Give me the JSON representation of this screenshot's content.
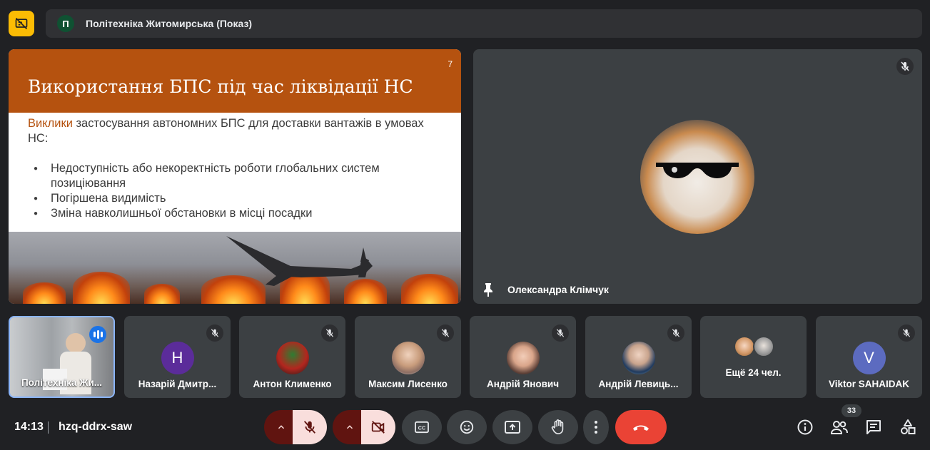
{
  "meeting": {
    "presenter_avatar_letter": "П",
    "presentation_title": "Політехніка Житомирська (Показ)",
    "time": "14:13",
    "code": "hzq-ddrx-saw",
    "participants_count": "33"
  },
  "slide": {
    "title": "Використання БПС під час ліквідації НС",
    "page_number": "7",
    "intro_highlight": "Виклики",
    "intro_rest": " застосування автономних БПС для доставки вантажів в умовах НС:",
    "bullets": [
      "Недоступність або некоректність роботи глобальних систем позиціювання",
      "Погіршена видимість",
      "Зміна навколишньої обстановки в місці посадки"
    ]
  },
  "pinned": {
    "name": "Олександра Клімчук"
  },
  "participants": [
    {
      "name": "Політехніка Жи...",
      "avatar": ""
    },
    {
      "name": "Назарій Дмитр...",
      "avatar": "Н",
      "color": "#5b2c9a"
    },
    {
      "name": "Антон Клименко",
      "avatar": "",
      "color": "#b3261e"
    },
    {
      "name": "Максим Лисенко",
      "avatar": "",
      "color": "#8d6e63"
    },
    {
      "name": "Андрій Янович",
      "avatar": "",
      "color": "#6d4c41"
    },
    {
      "name": "Андрій Левиць...",
      "avatar": "",
      "color": "#546e7a"
    },
    {
      "name": "Ещё 24 чел.",
      "avatar": ""
    },
    {
      "name": "Viktor SAHAIDAK",
      "avatar": "V",
      "color": "#5c6bc0"
    }
  ],
  "colors": {
    "accent_yellow": "#fbbc04",
    "slide_header": "#b5520f",
    "end_call": "#ea4335",
    "mic_off_bg": "#f9dedc",
    "speaking": "#1a73e8"
  },
  "icons": {
    "presenting": "present-off-icon",
    "mic_muted": "mic-off-icon",
    "pin": "pin-icon",
    "camera_off": "videocam-off-icon",
    "captions": "closed-caption-icon",
    "emoji": "emoji-icon",
    "present_screen": "present-screen-icon",
    "raise_hand": "hand-icon",
    "more": "more-vert-icon",
    "end_call": "call-end-icon",
    "info": "info-icon",
    "people": "people-icon",
    "chat": "chat-icon",
    "activities": "activities-icon"
  }
}
